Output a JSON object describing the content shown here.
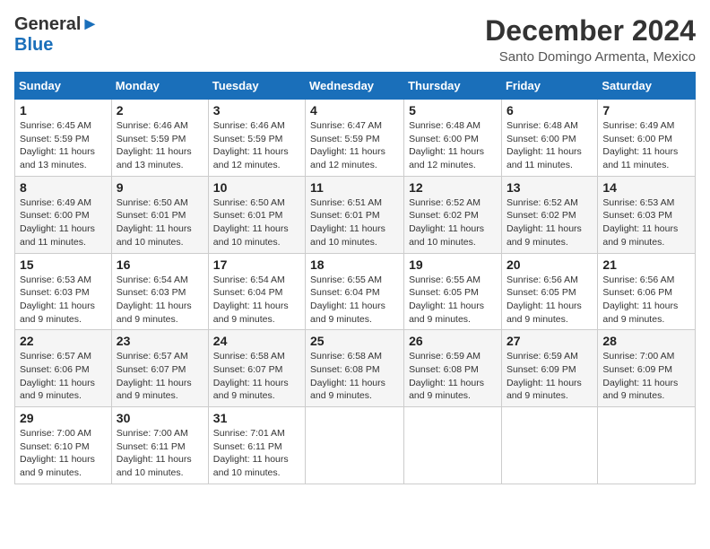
{
  "header": {
    "logo_line1": "General",
    "logo_line2": "Blue",
    "title": "December 2024",
    "subtitle": "Santo Domingo Armenta, Mexico"
  },
  "calendar": {
    "days_of_week": [
      "Sunday",
      "Monday",
      "Tuesday",
      "Wednesday",
      "Thursday",
      "Friday",
      "Saturday"
    ],
    "weeks": [
      [
        {
          "day": "1",
          "info": "Sunrise: 6:45 AM\nSunset: 5:59 PM\nDaylight: 11 hours\nand 13 minutes."
        },
        {
          "day": "2",
          "info": "Sunrise: 6:46 AM\nSunset: 5:59 PM\nDaylight: 11 hours\nand 13 minutes."
        },
        {
          "day": "3",
          "info": "Sunrise: 6:46 AM\nSunset: 5:59 PM\nDaylight: 11 hours\nand 12 minutes."
        },
        {
          "day": "4",
          "info": "Sunrise: 6:47 AM\nSunset: 5:59 PM\nDaylight: 11 hours\nand 12 minutes."
        },
        {
          "day": "5",
          "info": "Sunrise: 6:48 AM\nSunset: 6:00 PM\nDaylight: 11 hours\nand 12 minutes."
        },
        {
          "day": "6",
          "info": "Sunrise: 6:48 AM\nSunset: 6:00 PM\nDaylight: 11 hours\nand 11 minutes."
        },
        {
          "day": "7",
          "info": "Sunrise: 6:49 AM\nSunset: 6:00 PM\nDaylight: 11 hours\nand 11 minutes."
        }
      ],
      [
        {
          "day": "8",
          "info": "Sunrise: 6:49 AM\nSunset: 6:00 PM\nDaylight: 11 hours\nand 11 minutes."
        },
        {
          "day": "9",
          "info": "Sunrise: 6:50 AM\nSunset: 6:01 PM\nDaylight: 11 hours\nand 10 minutes."
        },
        {
          "day": "10",
          "info": "Sunrise: 6:50 AM\nSunset: 6:01 PM\nDaylight: 11 hours\nand 10 minutes."
        },
        {
          "day": "11",
          "info": "Sunrise: 6:51 AM\nSunset: 6:01 PM\nDaylight: 11 hours\nand 10 minutes."
        },
        {
          "day": "12",
          "info": "Sunrise: 6:52 AM\nSunset: 6:02 PM\nDaylight: 11 hours\nand 10 minutes."
        },
        {
          "day": "13",
          "info": "Sunrise: 6:52 AM\nSunset: 6:02 PM\nDaylight: 11 hours\nand 9 minutes."
        },
        {
          "day": "14",
          "info": "Sunrise: 6:53 AM\nSunset: 6:03 PM\nDaylight: 11 hours\nand 9 minutes."
        }
      ],
      [
        {
          "day": "15",
          "info": "Sunrise: 6:53 AM\nSunset: 6:03 PM\nDaylight: 11 hours\nand 9 minutes."
        },
        {
          "day": "16",
          "info": "Sunrise: 6:54 AM\nSunset: 6:03 PM\nDaylight: 11 hours\nand 9 minutes."
        },
        {
          "day": "17",
          "info": "Sunrise: 6:54 AM\nSunset: 6:04 PM\nDaylight: 11 hours\nand 9 minutes."
        },
        {
          "day": "18",
          "info": "Sunrise: 6:55 AM\nSunset: 6:04 PM\nDaylight: 11 hours\nand 9 minutes."
        },
        {
          "day": "19",
          "info": "Sunrise: 6:55 AM\nSunset: 6:05 PM\nDaylight: 11 hours\nand 9 minutes."
        },
        {
          "day": "20",
          "info": "Sunrise: 6:56 AM\nSunset: 6:05 PM\nDaylight: 11 hours\nand 9 minutes."
        },
        {
          "day": "21",
          "info": "Sunrise: 6:56 AM\nSunset: 6:06 PM\nDaylight: 11 hours\nand 9 minutes."
        }
      ],
      [
        {
          "day": "22",
          "info": "Sunrise: 6:57 AM\nSunset: 6:06 PM\nDaylight: 11 hours\nand 9 minutes."
        },
        {
          "day": "23",
          "info": "Sunrise: 6:57 AM\nSunset: 6:07 PM\nDaylight: 11 hours\nand 9 minutes."
        },
        {
          "day": "24",
          "info": "Sunrise: 6:58 AM\nSunset: 6:07 PM\nDaylight: 11 hours\nand 9 minutes."
        },
        {
          "day": "25",
          "info": "Sunrise: 6:58 AM\nSunset: 6:08 PM\nDaylight: 11 hours\nand 9 minutes."
        },
        {
          "day": "26",
          "info": "Sunrise: 6:59 AM\nSunset: 6:08 PM\nDaylight: 11 hours\nand 9 minutes."
        },
        {
          "day": "27",
          "info": "Sunrise: 6:59 AM\nSunset: 6:09 PM\nDaylight: 11 hours\nand 9 minutes."
        },
        {
          "day": "28",
          "info": "Sunrise: 7:00 AM\nSunset: 6:09 PM\nDaylight: 11 hours\nand 9 minutes."
        }
      ],
      [
        {
          "day": "29",
          "info": "Sunrise: 7:00 AM\nSunset: 6:10 PM\nDaylight: 11 hours\nand 9 minutes."
        },
        {
          "day": "30",
          "info": "Sunrise: 7:00 AM\nSunset: 6:11 PM\nDaylight: 11 hours\nand 10 minutes."
        },
        {
          "day": "31",
          "info": "Sunrise: 7:01 AM\nSunset: 6:11 PM\nDaylight: 11 hours\nand 10 minutes."
        },
        {
          "day": "",
          "info": ""
        },
        {
          "day": "",
          "info": ""
        },
        {
          "day": "",
          "info": ""
        },
        {
          "day": "",
          "info": ""
        }
      ]
    ]
  }
}
